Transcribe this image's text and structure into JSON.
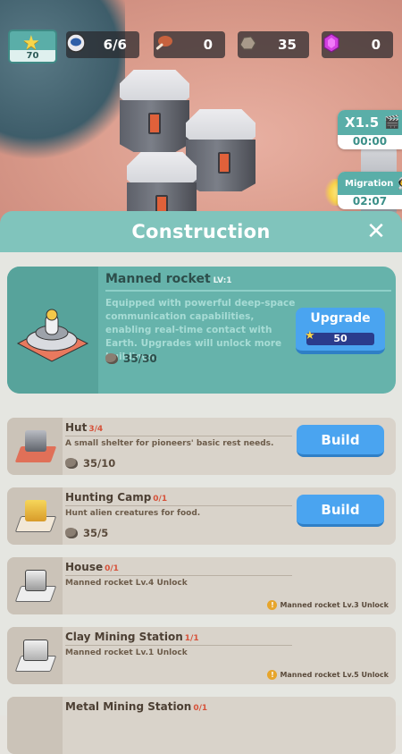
{
  "hud": {
    "level": "70",
    "population": "6/6",
    "food": "0",
    "stone": "35",
    "gems": "0"
  },
  "side": {
    "speed_label": "X1.5",
    "speed_timer": "00:00",
    "migration_label": "Migration",
    "migration_timer": "02:07"
  },
  "panel": {
    "title": "Construction",
    "close_icon": "close-icon"
  },
  "featured": {
    "name": "Manned rocket",
    "level": "LV:1",
    "description": "Equipped with powerful deep-space communication capabilities, enabling real-time contact with Earth. Upgrades will unlock more buildings.",
    "cost": "35/30",
    "button_label": "Upgrade",
    "upgrade_cost": "50"
  },
  "buildings": [
    {
      "name": "Hut",
      "count": "3/4",
      "description": "A small shelter for pioneers' basic rest needs.",
      "cost": "35/10",
      "button": "Build",
      "lock": ""
    },
    {
      "name": "Hunting Camp",
      "count": "0/1",
      "description": "Hunt alien creatures for food.",
      "cost": "35/5",
      "button": "Build",
      "lock": ""
    },
    {
      "name": "House",
      "count": "0/1",
      "description": "Manned rocket Lv.4 Unlock",
      "cost": "",
      "button": "",
      "lock": "Manned rocket Lv.3 Unlock"
    },
    {
      "name": "Clay Mining Station",
      "count": "1/1",
      "description": "Manned rocket Lv.1 Unlock",
      "cost": "",
      "button": "",
      "lock": "Manned rocket Lv.5 Unlock"
    },
    {
      "name": "Metal Mining Station",
      "count": "0/1",
      "description": "",
      "cost": "",
      "button": "",
      "lock": ""
    }
  ],
  "colors": {
    "accent": "#80c4bc",
    "button": "#4aa4f0",
    "count_red": "#d6523a"
  }
}
